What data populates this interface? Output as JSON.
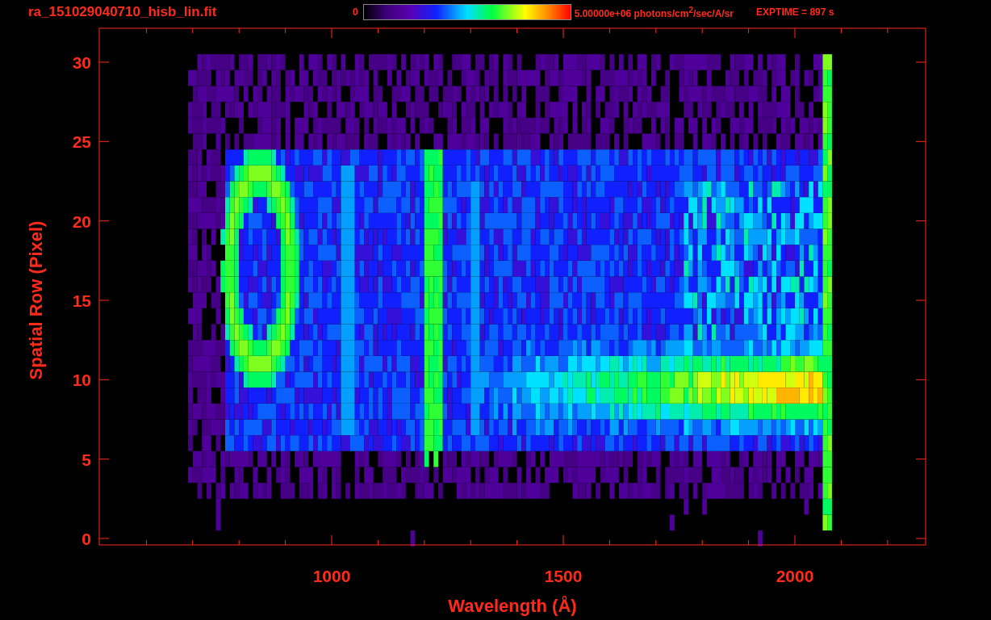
{
  "header": {
    "filename": "ra_151029040710_hisb_lin.fit",
    "colorbar": {
      "min_label": "0",
      "max_label": "5.00000e+06 photons/cm$^{2}$/sec/A/sr"
    },
    "exposure": "EXPTIME = 897 s"
  },
  "plot": {
    "xlabel": "Wavelength (Å)",
    "ylabel": "Spatial Row (Pixel)",
    "xticks": [
      "1000",
      "1500",
      "2000"
    ],
    "yticks": [
      "30",
      "25",
      "20",
      "15",
      "10",
      "5",
      "0"
    ]
  }
}
